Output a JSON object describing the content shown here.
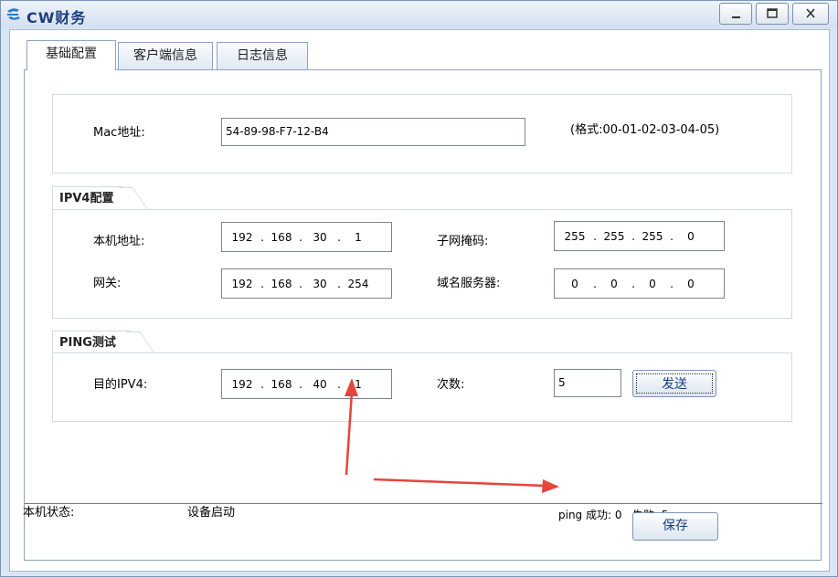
{
  "window": {
    "title": "CW财务",
    "minimize_label": "_",
    "maximize_label": "□",
    "close_label": "X"
  },
  "tabs": [
    {
      "label": "基础配置",
      "active": true
    },
    {
      "label": "客户端信息",
      "active": false
    },
    {
      "label": "日志信息",
      "active": false
    }
  ],
  "mac": {
    "label": "Mac地址:",
    "value": "54-89-98-F7-12-B4",
    "format_hint": "(格式:00-01-02-03-04-05)"
  },
  "ipv4": {
    "group_title": "IPV4配置",
    "local_label": "本机地址:",
    "local_ip": [
      "192",
      "168",
      "30",
      "1"
    ],
    "subnet_label": "子网掩码:",
    "subnet": [
      "255",
      "255",
      "255",
      "0"
    ],
    "gateway_label": "网关:",
    "gateway": [
      "192",
      "168",
      "30",
      "254"
    ],
    "dns_label": "域名服务器:",
    "dns": [
      "0",
      "0",
      "0",
      "0"
    ]
  },
  "ping": {
    "group_title": "PING测试",
    "target_label": "目的IPV4:",
    "target_ip": [
      "192",
      "168",
      "40",
      "1"
    ],
    "count_label": "次数:",
    "count_value": "5",
    "send_label": "发送"
  },
  "status": {
    "label": "本机状态:",
    "value": "设备启动",
    "ping_result": "ping 成功: 0   失败: 5"
  },
  "save_label": "保存",
  "colors": {
    "title_text": "#1c3f7a",
    "annotation_arrow": "#e8443a"
  }
}
